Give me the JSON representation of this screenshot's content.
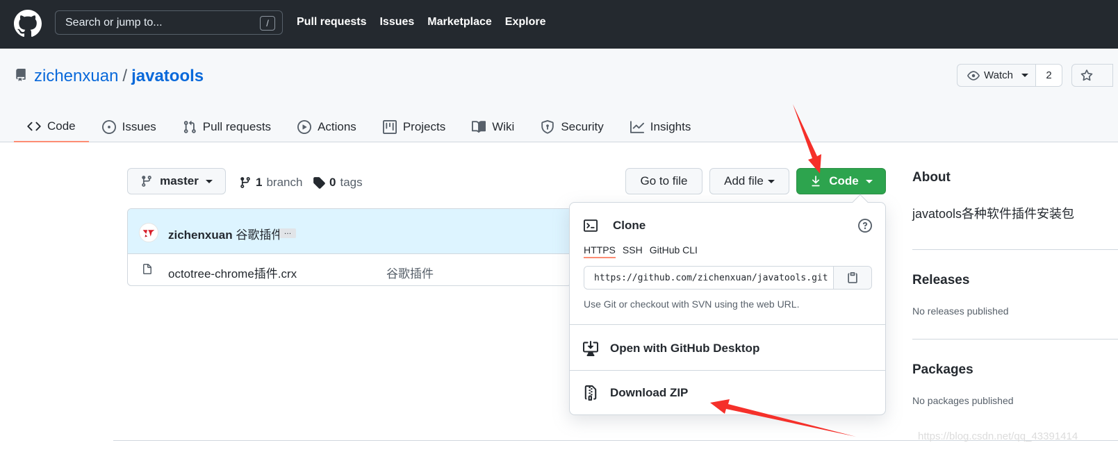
{
  "header": {
    "search_placeholder": "Search or jump to...",
    "search_shortcut": "/",
    "nav": [
      "Pull requests",
      "Issues",
      "Marketplace",
      "Explore"
    ]
  },
  "repo": {
    "owner": "zichenxuan",
    "separator": "/",
    "name": "javatools",
    "watch_label": "Watch",
    "watch_count": "2"
  },
  "tabs": [
    {
      "label": "Code",
      "icon": "code-icon"
    },
    {
      "label": "Issues",
      "icon": "issue-icon"
    },
    {
      "label": "Pull requests",
      "icon": "pull-request-icon"
    },
    {
      "label": "Actions",
      "icon": "play-icon"
    },
    {
      "label": "Projects",
      "icon": "project-icon"
    },
    {
      "label": "Wiki",
      "icon": "book-icon"
    },
    {
      "label": "Security",
      "icon": "shield-icon"
    },
    {
      "label": "Insights",
      "icon": "graph-icon"
    }
  ],
  "toolbar": {
    "branch": "master",
    "branch_count": "1",
    "branch_label": "branch",
    "tag_count": "0",
    "tag_label": "tags",
    "go_to_file": "Go to file",
    "add_file": "Add file",
    "code": "Code"
  },
  "commit": {
    "author": "zichenxuan",
    "message": "谷歌插件",
    "ellipsis": "…"
  },
  "files": [
    {
      "name": "octotree-chrome插件.crx",
      "commit": "谷歌插件"
    }
  ],
  "clone_menu": {
    "title": "Clone",
    "protocols": [
      "HTTPS",
      "SSH",
      "GitHub CLI"
    ],
    "url": "https://github.com/zichenxuan/javatools.git",
    "help": "Use Git or checkout with SVN using the web URL.",
    "open_desktop": "Open with GitHub Desktop",
    "download_zip": "Download ZIP"
  },
  "about": {
    "title": "About",
    "description": "javatools各种软件插件安装包",
    "releases_title": "Releases",
    "releases_text": "No releases published",
    "packages_title": "Packages",
    "packages_text": "No packages published"
  },
  "watermark": "https://blog.csdn.net/qq_43391414",
  "colors": {
    "header_bg": "#24292f",
    "link": "#0969da",
    "green": "#2da44e",
    "tab_underline": "#fd8c73",
    "annotation_red": "#f5302a"
  }
}
